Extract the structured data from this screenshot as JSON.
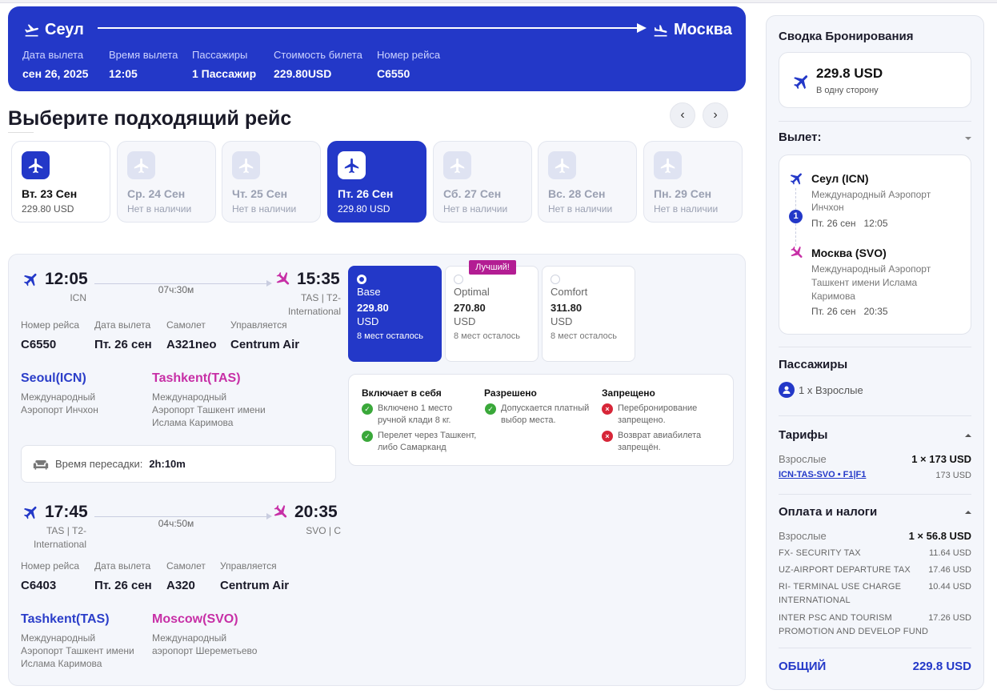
{
  "header": {
    "from_city": "Сеул",
    "to_city": "Москва",
    "fields": [
      {
        "label": "Дата вылета",
        "value": "сен 26, 2025"
      },
      {
        "label": "Время вылета",
        "value": "12:05"
      },
      {
        "label": "Пассажиры",
        "value": "1 Пассажир"
      },
      {
        "label": "Стоимость билета",
        "value": "229.80USD"
      },
      {
        "label": "Номер рейса",
        "value": "C6550"
      }
    ]
  },
  "section_title": "Выберите подходящий рейс",
  "days": [
    {
      "date": "Вт. 23 Сен",
      "price": "229.80 USD"
    },
    {
      "date": "Ср. 24 Сен",
      "price": "Нет в наличии"
    },
    {
      "date": "Чт. 25 Сен",
      "price": "Нет в наличии"
    },
    {
      "date": "Пт. 26 Сен",
      "price": "229.80 USD"
    },
    {
      "date": "Сб. 27 Сен",
      "price": "Нет в наличии"
    },
    {
      "date": "Вс. 28 Сен",
      "price": "Нет в наличии"
    },
    {
      "date": "Пн. 29 Сен",
      "price": "Нет в наличии"
    }
  ],
  "seg1": {
    "dep_time": "12:05",
    "arr_time": "15:35",
    "duration": "07ч:30м",
    "dep_code": "ICN",
    "arr_code_1": "TAS | T2-",
    "arr_code_2": "International",
    "labels": [
      "Номер рейса",
      "Дата вылета",
      "Самолет",
      "Управляется"
    ],
    "values": [
      "C6550",
      "Пт. 26 сен",
      "A321neo",
      "Centrum Air"
    ],
    "from_city": "Seoul(ICN)",
    "from_airport_1": "Международный",
    "from_airport_2": "Аэропорт Инчхон",
    "to_city": "Tashkent(TAS)",
    "to_airport_1": "Международный",
    "to_airport_2": "Аэропорт Ташкент имени",
    "to_airport_3": "Ислама Каримова"
  },
  "transfer": {
    "label": "Время пересадки:",
    "value": "2h:10m"
  },
  "seg2": {
    "dep_time": "17:45",
    "arr_time": "20:35",
    "duration": "04ч:50м",
    "dep_code_1": "TAS | T2-",
    "dep_code_2": "International",
    "arr_code": "SVO | C",
    "labels": [
      "Номер рейса",
      "Дата вылета",
      "Самолет",
      "Управляется"
    ],
    "values": [
      "C6403",
      "Пт. 26 сен",
      "A320",
      "Centrum Air"
    ],
    "from_city": "Tashkent(TAS)",
    "from_airport_1": "Международный",
    "from_airport_2": "Аэропорт Ташкент имени",
    "from_airport_3": "Ислама Каримова",
    "to_city": "Moscow(SVO)",
    "to_airport_1": "Международный",
    "to_airport_2": "аэропорт Шереметьево"
  },
  "fares": [
    {
      "name": "Base",
      "price": "229.80",
      "currency": "USD",
      "seats": "8 мест осталось"
    },
    {
      "name": "Optimal",
      "price": "270.80",
      "currency": "USD",
      "seats": "8 мест осталось"
    },
    {
      "name": "Comfort",
      "price": "311.80",
      "currency": "USD",
      "seats": "8 мест осталось"
    }
  ],
  "best_badge": "Лучший!",
  "rules": {
    "included_title": "Включает в себя",
    "included": [
      [
        "Включено 1 место",
        "ручной клади 8 кг."
      ],
      [
        "Перелет через Ташкент,",
        "либо Самарканд"
      ]
    ],
    "allowed_title": "Разрешено",
    "allowed": [
      [
        "Допускается платный",
        "выбор места."
      ]
    ],
    "forbidden_title": "Запрещено",
    "forbidden": [
      [
        "Перебронирование",
        "запрещено."
      ],
      [
        "Возврат авиабилета",
        "запрещён."
      ]
    ]
  },
  "summary": {
    "title": "Сводка Бронирования",
    "price": "229.8 USD",
    "price_note": "В одну сторону",
    "departure_title": "Вылет:",
    "stops": "1",
    "dep": {
      "city": "Сеул (ICN)",
      "airport_1": "Международный Аэропорт",
      "airport_2": "Инчхон",
      "date": "Пт. 26 сен",
      "time": "12:05"
    },
    "arr": {
      "city": "Москва (SVO)",
      "airport_1": "Международный Аэропорт",
      "airport_2": "Ташкент имени Ислама",
      "airport_3": "Каримова",
      "date": "Пт. 26 сен",
      "time": "20:35"
    },
    "passengers_title": "Пассажиры",
    "passengers": "1 x Взрослые",
    "fares_title": "Тарифы",
    "fare_label": "Взрослые",
    "fare_value": "1 × 173 USD",
    "fare_route": "ICN-TAS-SVO • F1|F1",
    "fare_route_value": "173 USD",
    "taxes_title": "Оплата и налоги",
    "tax_label": "Взрослые",
    "tax_value": "1 × 56.8 USD",
    "taxes": [
      {
        "name_1": "FX- SECURITY TAX",
        "name_2": "",
        "value": "11.64 USD"
      },
      {
        "name_1": "UZ-AIRPORT DEPARTURE TAX",
        "name_2": "",
        "value": "17.46 USD"
      },
      {
        "name_1": "RI- TERMINAL USE CHARGE",
        "name_2": "INTERNATIONAL",
        "value": "10.44 USD"
      },
      {
        "name_1": "INTER PSC AND TOURISM",
        "name_2": "PROMOTION AND DEVELOP FUND",
        "value": "17.26 USD"
      }
    ],
    "total_label": "ОБЩИЙ",
    "total_value": "229.8 USD"
  },
  "colors": {
    "brand": "#2338c8",
    "accent": "#c72fa6",
    "ok": "#3aa83a",
    "no": "#d72638"
  },
  "icons": [
    "plane-departure-icon",
    "plane-arrival-icon",
    "chevron-left-icon",
    "chevron-right-icon",
    "sofa-icon",
    "check-icon",
    "cross-icon",
    "user-icon",
    "caret-icon"
  ]
}
